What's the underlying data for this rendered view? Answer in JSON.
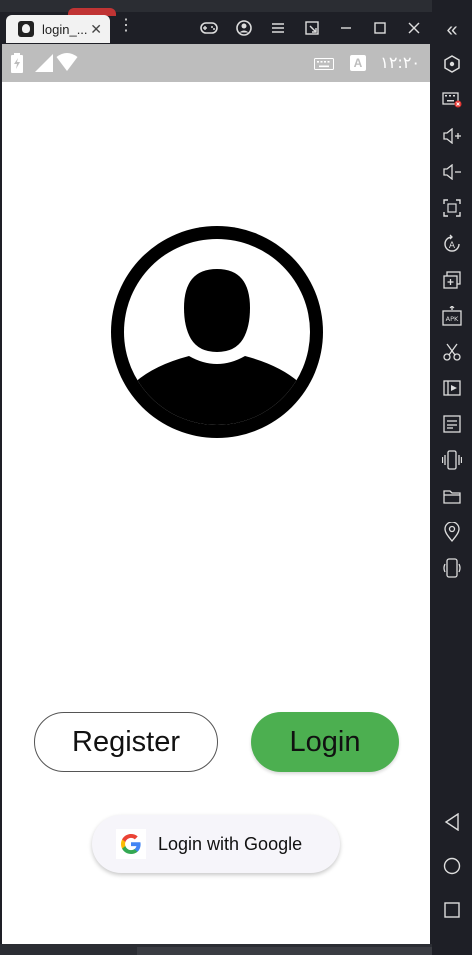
{
  "window": {
    "tab_title": "login_...",
    "tab_close": "✕",
    "menu_dots": "⋮"
  },
  "statusbar": {
    "clock": "۱۲:۲۰",
    "keyboard_badge": "A"
  },
  "app": {
    "register_label": "Register",
    "login_label": "Login",
    "google_label": "Login with Google"
  },
  "colors": {
    "login_green": "#4caf50",
    "status_gray": "#bdbdbd",
    "chrome_dark": "#1e1f26"
  },
  "sidebar": {
    "collapse_glyph": "«",
    "icons": [
      "settings-hex-icon",
      "keyboard-off-icon",
      "volume-up-icon",
      "volume-down-icon",
      "screenshot-icon",
      "rotate-a-icon",
      "add-window-icon",
      "apk-icon",
      "cut-icon",
      "video-icon",
      "notes-icon",
      "shake-icon",
      "folder-icon",
      "location-icon",
      "vibrate-icon",
      "back-icon",
      "home-icon",
      "recents-icon"
    ]
  }
}
